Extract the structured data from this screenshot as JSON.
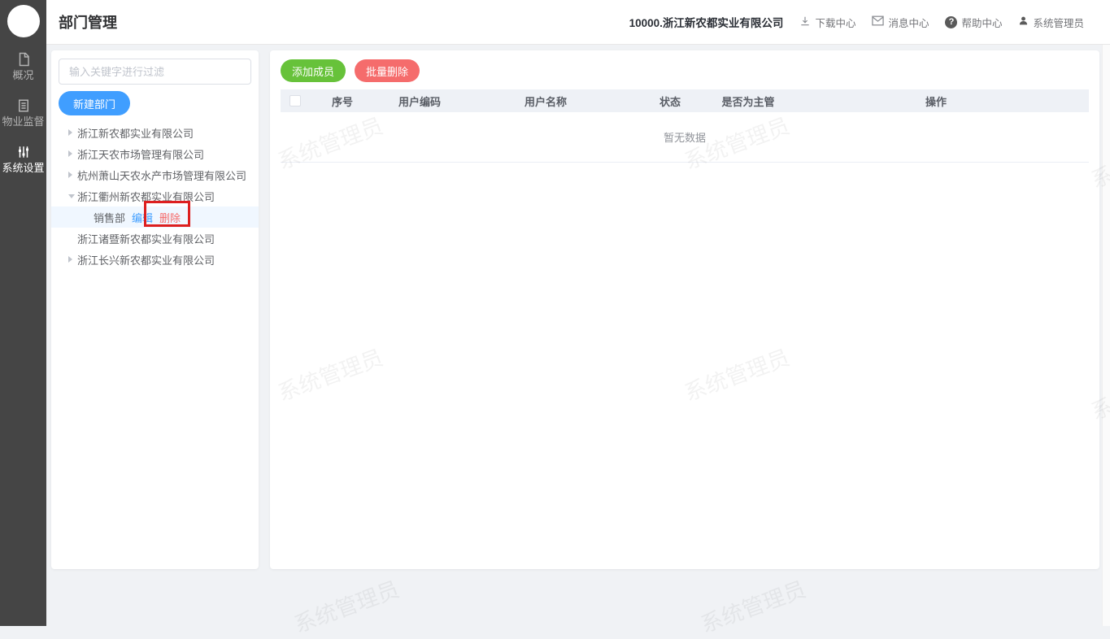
{
  "topbar": {
    "title": "部门管理",
    "company": "10000.浙江新农都实业有限公司",
    "links": [
      {
        "icon": "download-icon",
        "label": "下载中心"
      },
      {
        "icon": "mail-icon",
        "label": "消息中心"
      },
      {
        "icon": "help-icon",
        "label": "帮助中心"
      },
      {
        "icon": "user-icon",
        "label": "系统管理员"
      }
    ]
  },
  "sidebar": {
    "items": [
      {
        "icon": "file-icon",
        "label": "概况",
        "active": false
      },
      {
        "icon": "document-list-icon",
        "label": "物业监督",
        "active": false
      },
      {
        "icon": "sliders-icon",
        "label": "系统设置",
        "active": true
      }
    ]
  },
  "tree_panel": {
    "filter_placeholder": "输入关键字进行过滤",
    "new_dept_button": "新建部门",
    "items": [
      {
        "state": "collapsed",
        "label": "浙江新农都实业有限公司"
      },
      {
        "state": "collapsed",
        "label": "浙江天农市场管理有限公司"
      },
      {
        "state": "collapsed",
        "label": "杭州萧山天农水产市场管理有限公司"
      },
      {
        "state": "expanded",
        "label": "浙江衢州新农都实业有限公司"
      },
      {
        "state": "leaf-selected",
        "label": "销售部",
        "actions": [
          "编辑",
          "删除"
        ]
      },
      {
        "state": "leaf",
        "label": "浙江诸暨新农都实业有限公司"
      },
      {
        "state": "collapsed",
        "label": "浙江长兴新农都实业有限公司"
      }
    ]
  },
  "table_panel": {
    "add_member_button": "添加成员",
    "batch_delete_button": "批量删除",
    "columns": [
      "序号",
      "用户编码",
      "用户名称",
      "状态",
      "是否为主管",
      "操作"
    ],
    "empty_text": "暂无数据",
    "rows": []
  },
  "watermark": {
    "text": "系统管理员"
  },
  "help_icon_glyph": "?",
  "colors": {
    "accent": "#409eff",
    "success": "#67c23a",
    "danger": "#f56c6c",
    "annotation_red": "#dd1f1f",
    "sidebar_bg": "#454545",
    "table_header_bg": "#eef1f6",
    "selected_row_bg": "#f0f7ff",
    "page_bg": "#f0f2f5"
  }
}
